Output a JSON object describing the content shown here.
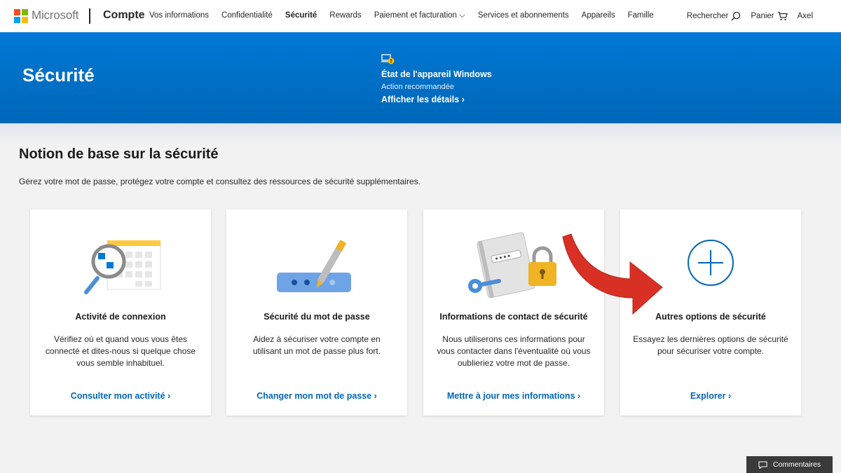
{
  "header": {
    "brand": "Microsoft",
    "product": "Compte",
    "nav": [
      "Vos informations",
      "Confidentialité",
      "Sécurité",
      "Rewards",
      "Paiement et facturation ⌵",
      "Services et abonnements",
      "Appareils",
      "Famille"
    ],
    "active_nav": "Sécurité",
    "search_label": "Rechercher",
    "cart_label": "Panier",
    "user": "Axel"
  },
  "hero": {
    "title": "Sécurité",
    "device_title": "État de l'appareil Windows",
    "device_subtitle": "Action recommandée",
    "device_link": "Afficher les détails ›"
  },
  "section": {
    "title": "Notion de base sur la sécurité",
    "description": "Gérez votre mot de passe, protégez votre compte et consultez des ressources de sécurité supplémentaires."
  },
  "cards": [
    {
      "title": "Activité de connexion",
      "description": "Vérifiez où et quand vous vous êtes connecté et dites-nous si quelque chose vous semble inhabituel.",
      "link": "Consulter mon activité ›",
      "icon": "calendar-magnifier-icon"
    },
    {
      "title": "Sécurité du mot de passe",
      "description": "Aidez à sécuriser votre compte en utilisant un mot de passe plus fort.",
      "link": "Changer mon mot de passe ›",
      "icon": "password-pen-icon"
    },
    {
      "title": "Informations de contact de sécurité",
      "description": "Nous utiliserons ces informations pour vous contacter dans l'éventualité où vous oublieriez votre mot de passe.",
      "link": "Mettre à jour mes informations ›",
      "icon": "contact-lock-icon"
    },
    {
      "title": "Autres options de sécurité",
      "description": "Essayez les dernières options de sécurité pour sécuriser votre compte.",
      "link": "Explorer ›",
      "icon": "plus-circle-icon"
    }
  ],
  "feedback": "Commentaires",
  "colors": {
    "accent": "#0067b8",
    "hero": "#0078d4",
    "annotation_arrow": "#d93025"
  }
}
